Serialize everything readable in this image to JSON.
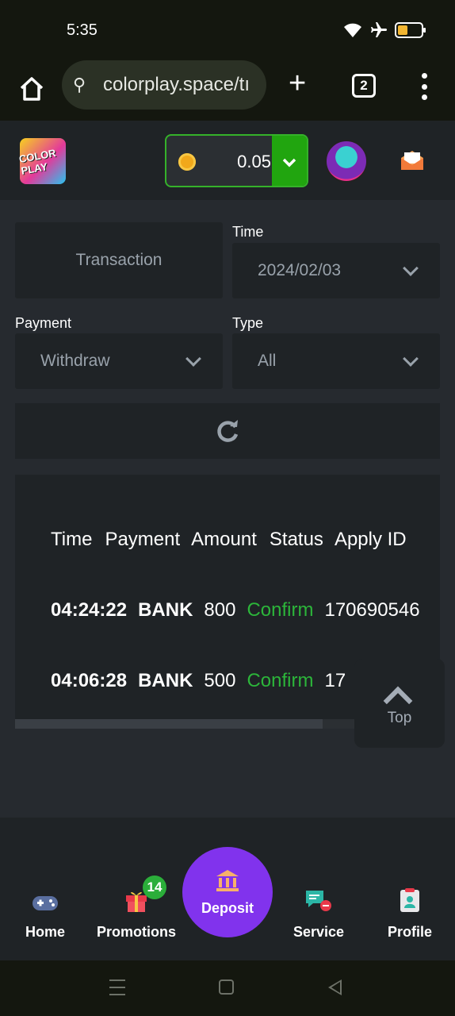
{
  "status_bar": {
    "time": "5:35"
  },
  "browser": {
    "url": "colorplay.space/tı",
    "tab_count": "2"
  },
  "header": {
    "logo_text": "COLOR PLAY",
    "balance": "0.05"
  },
  "filters": {
    "tab_transaction": "Transaction",
    "time_label": "Time",
    "time_value": "2024/02/03",
    "payment_label": "Payment",
    "payment_value": "Withdraw",
    "type_label": "Type",
    "type_value": "All"
  },
  "table": {
    "headers": [
      "Time",
      "Payment",
      "Amount",
      "Status",
      "Apply ID"
    ],
    "rows": [
      {
        "time": "04:24:22",
        "payment": "BANK",
        "amount": "800",
        "status": "Confirm",
        "apply_id": "170690546"
      },
      {
        "time": "04:06:28",
        "payment": "BANK",
        "amount": "500",
        "status": "Confirm",
        "apply_id": "17"
      }
    ]
  },
  "top_button": "Top",
  "bottom_nav": {
    "home": "Home",
    "promotions": "Promotions",
    "promotions_badge": "14",
    "deposit": "Deposit",
    "service": "Service",
    "profile": "Profile"
  },
  "colors": {
    "accent_green": "#21a50f",
    "status_confirm": "#2cb53a",
    "deposit_purple": "#8133ed",
    "panel_bg": "#1f2326"
  }
}
